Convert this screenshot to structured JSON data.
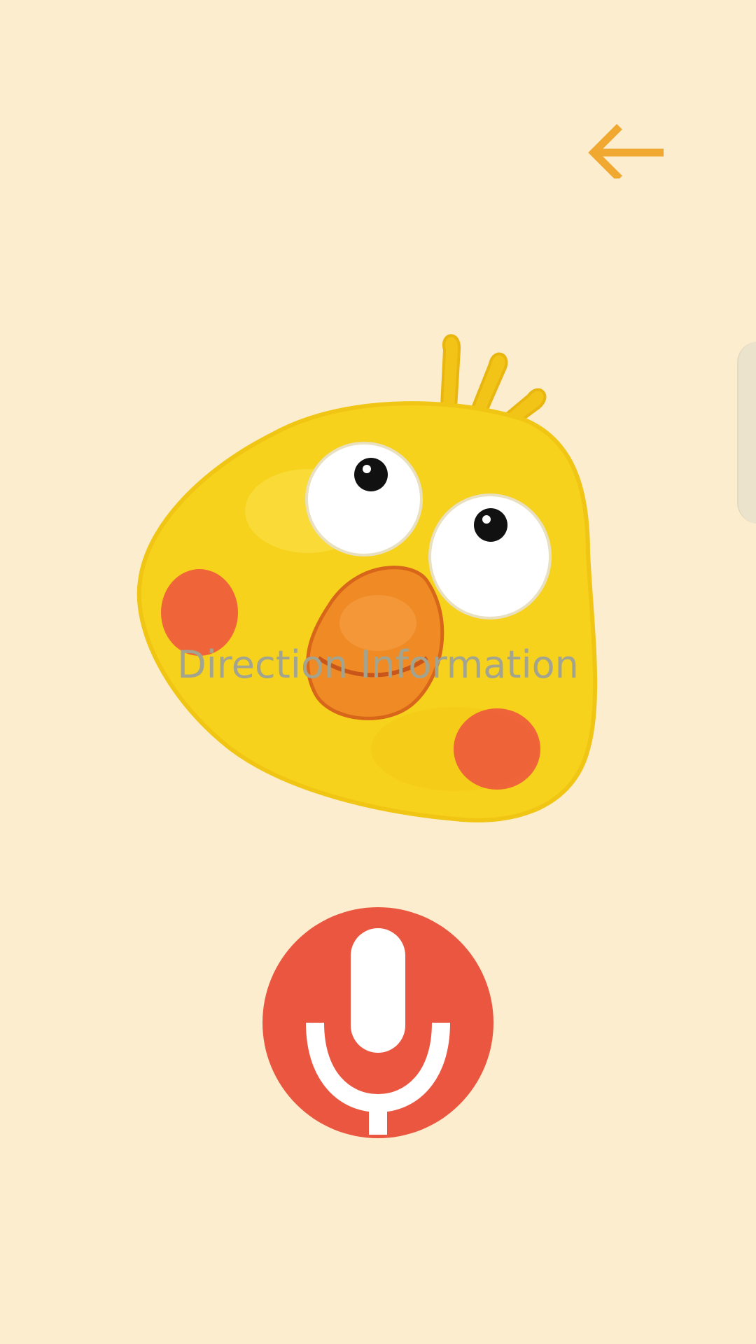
{
  "screen": {
    "background_color": "#fbedcd",
    "label_text": "Direction Information",
    "label_color": "#a3a48f"
  },
  "toolbar": {
    "back_icon": "arrow-left-icon",
    "back_color": "#f0a830"
  },
  "mascot": {
    "icon": "yellow-bird-mascot",
    "body_color": "#f7d21c",
    "beak_color": "#f08a24",
    "cheek_color": "#ee5a3c"
  },
  "mic": {
    "icon": "microphone-icon",
    "button_color": "#ea563f"
  }
}
